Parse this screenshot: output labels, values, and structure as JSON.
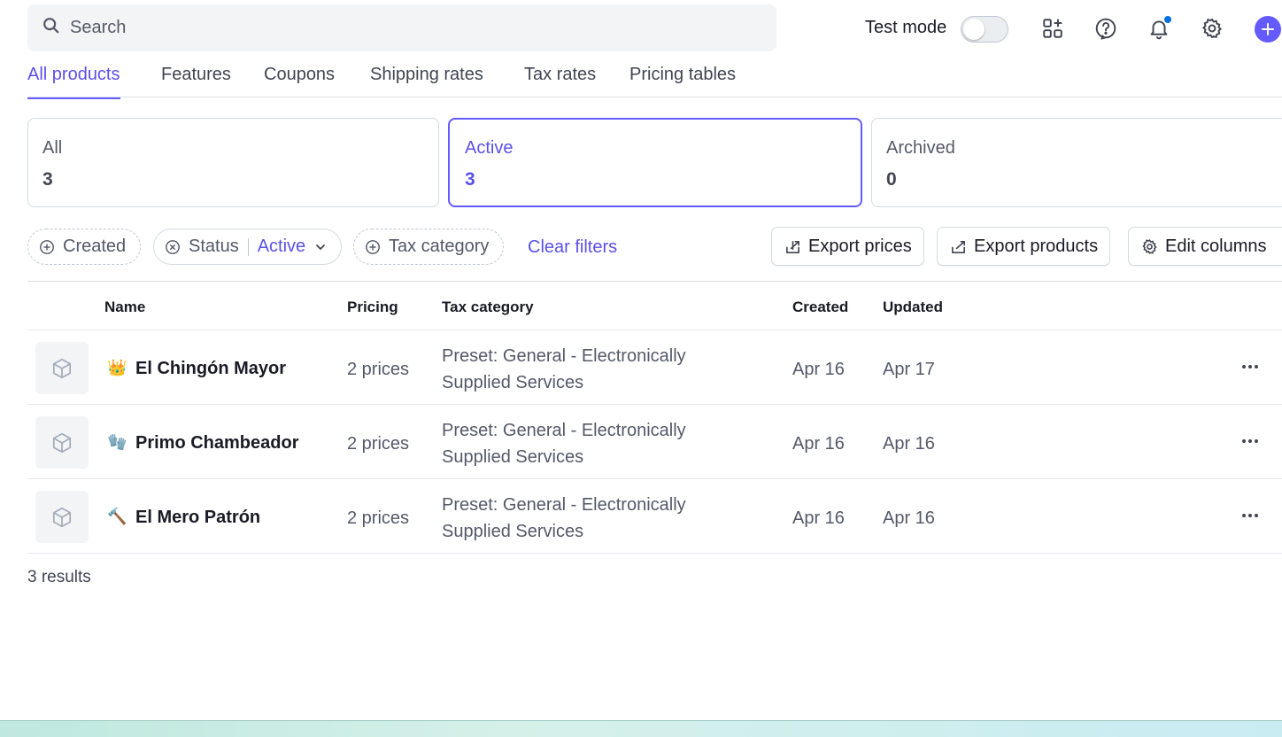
{
  "search": {
    "placeholder": "Search"
  },
  "header": {
    "test_mode_label": "Test mode",
    "test_mode_on": false,
    "icons": [
      "apps-add-icon",
      "help-icon",
      "bell-icon",
      "gear-icon",
      "plus-icon"
    ],
    "accent": "#635bff"
  },
  "tabs": [
    {
      "label": "All products",
      "active": true
    },
    {
      "label": "Features",
      "active": false
    },
    {
      "label": "Coupons",
      "active": false
    },
    {
      "label": "Shipping rates",
      "active": false
    },
    {
      "label": "Tax rates",
      "active": false
    },
    {
      "label": "Pricing tables",
      "active": false
    }
  ],
  "status_cards": [
    {
      "label": "All",
      "count": "3",
      "active": false
    },
    {
      "label": "Active",
      "count": "3",
      "active": true
    },
    {
      "label": "Archived",
      "count": "0",
      "active": false
    }
  ],
  "filters": {
    "created": "Created",
    "status_label": "Status",
    "status_value": "Active",
    "tax_category": "Tax category",
    "clear": "Clear filters"
  },
  "actions": {
    "export_prices": "Export prices",
    "export_products": "Export products",
    "edit_columns": "Edit columns"
  },
  "table": {
    "headers": {
      "name": "Name",
      "pricing": "Pricing",
      "tax_category": "Tax category",
      "created": "Created",
      "updated": "Updated"
    },
    "rows": [
      {
        "emoji": "👑",
        "name": "El Chingón Mayor",
        "pricing": "2 prices",
        "tax_category": "Preset: General - Electronically Supplied Services",
        "created": "Apr 16",
        "updated": "Apr 17"
      },
      {
        "emoji": "🧤",
        "name": "Primo Chambeador",
        "pricing": "2 prices",
        "tax_category": "Preset: General - Electronically Supplied Services",
        "created": "Apr 16",
        "updated": "Apr 16"
      },
      {
        "emoji": "🔨",
        "name": "El Mero Patrón",
        "pricing": "2 prices",
        "tax_category": "Preset: General - Electronically Supplied Services",
        "created": "Apr 16",
        "updated": "Apr 16"
      }
    ]
  },
  "footer": {
    "results": "3 results"
  }
}
